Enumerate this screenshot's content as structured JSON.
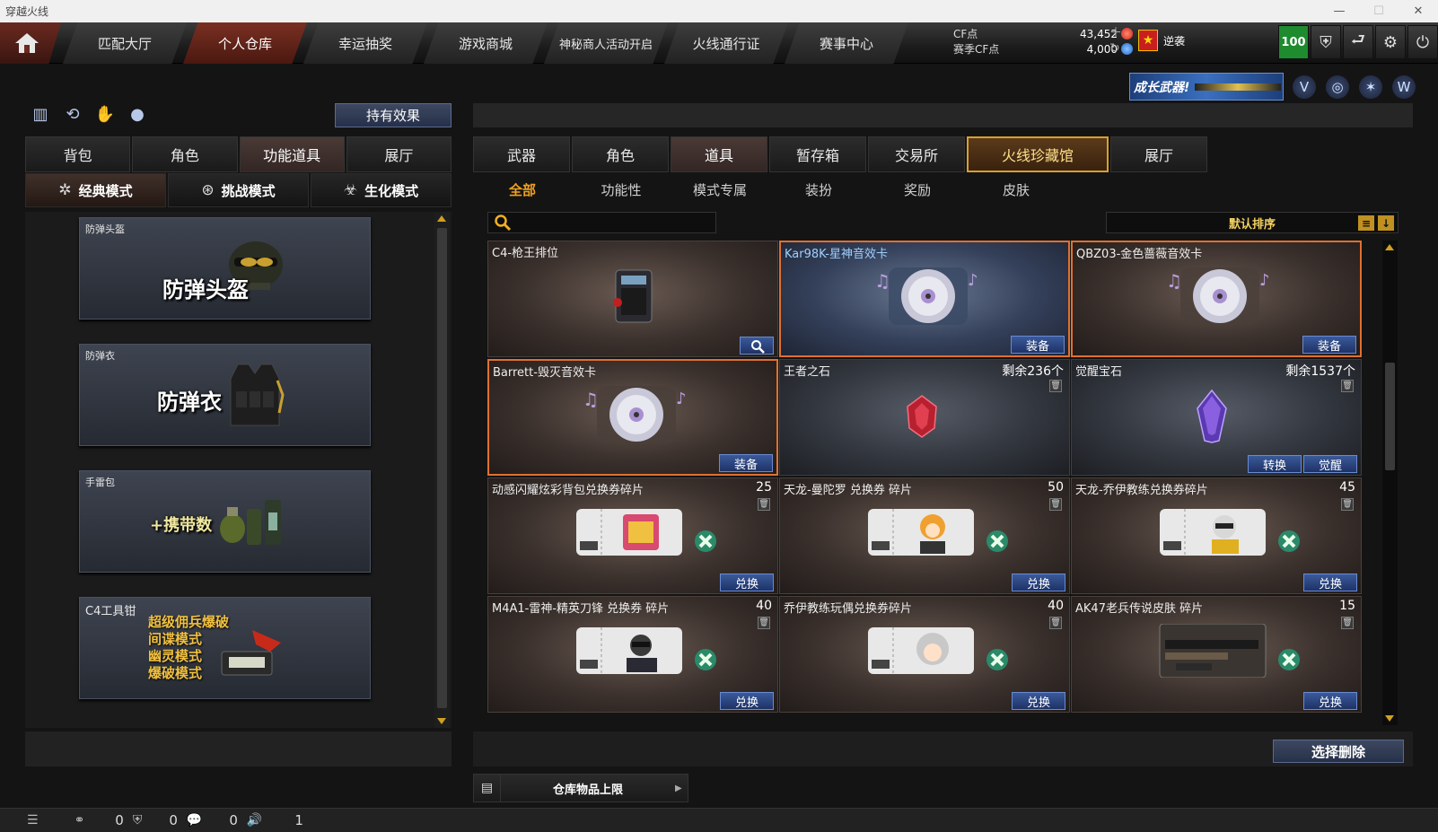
{
  "window": {
    "title": "穿越火线",
    "minimize": "—",
    "maximize": "☐",
    "close": "✕"
  },
  "topnav": {
    "tabs": [
      "匹配大厅",
      "个人仓库",
      "幸运抽奖",
      "游戏商城",
      "神秘商人活动开启",
      "火线通行证",
      "赛事中心"
    ],
    "active_index": 1,
    "cf_label": "CF点",
    "cf_value": "43,452",
    "season_label": "赛季CF点",
    "season_value": "4,000",
    "rank_name": "逆袭",
    "level": "100"
  },
  "left": {
    "hold_effect": "持有效果",
    "tabs": [
      "背包",
      "角色",
      "功能道具",
      "展厅"
    ],
    "modes": [
      "经典模式",
      "挑战模式",
      "生化模式"
    ],
    "cards": [
      {
        "caption": "防弹头盔",
        "big": "防弹头盔"
      },
      {
        "caption": "防弹衣",
        "big": "防弹衣"
      },
      {
        "caption": "手雷包",
        "big": "+携带数"
      },
      {
        "caption": "C4工具钳",
        "lines": [
          "超级佣兵爆破",
          "间谍模式",
          "幽灵模式",
          "爆破模式"
        ]
      }
    ]
  },
  "right": {
    "promo": "成长武器!",
    "categories": [
      "武器",
      "角色",
      "道具",
      "暂存箱",
      "交易所",
      "火线珍藏馆",
      "展厅"
    ],
    "subtabs": [
      "全部",
      "功能性",
      "模式专属",
      "装扮",
      "奖励",
      "皮肤"
    ],
    "sort_label": "默认排序",
    "items": [
      {
        "name": "C4-枪王排位"
      },
      {
        "name": "Kar98K-星神音效卡",
        "action": "装备"
      },
      {
        "name": "QBZ03-金色蔷薇音效卡",
        "action": "装备"
      },
      {
        "name": "Barrett-毁灭音效卡",
        "action": "装备"
      },
      {
        "name": "王者之石",
        "count": "剩余236个"
      },
      {
        "name": "觉醒宝石",
        "count": "剩余1537个",
        "action": "转换",
        "action2": "觉醒"
      },
      {
        "name": "动感闪耀炫彩背包兑换券碎片",
        "count": "25",
        "action": "兑换"
      },
      {
        "name": "天龙-曼陀罗 兑换券 碎片",
        "count": "50",
        "action": "兑换"
      },
      {
        "name": "天龙-乔伊教练兑换券碎片",
        "count": "45",
        "action": "兑换"
      },
      {
        "name": "M4A1-雷神-精英刀锋 兑换券 碎片",
        "count": "40",
        "action": "兑换"
      },
      {
        "name": "乔伊教练玩偶兑换券碎片",
        "count": "40",
        "action": "兑换"
      },
      {
        "name": "AK47老兵传说皮肤 碎片",
        "count": "15",
        "action": "兑换"
      }
    ],
    "delete_selected": "选择删除",
    "capacity_label": "仓库物品上限"
  },
  "statusbar": {
    "v1": "0",
    "v2": "0",
    "v3": "0",
    "v4": "1"
  }
}
